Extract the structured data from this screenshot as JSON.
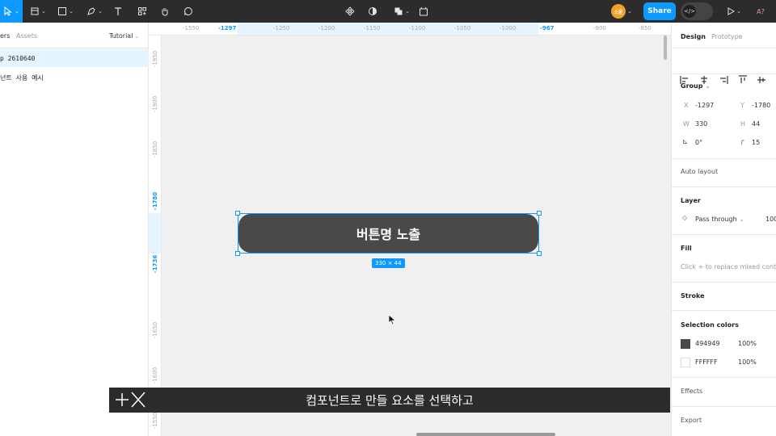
{
  "toolbar": {
    "share_label": "Share",
    "avatar_initials": "소윤",
    "zoom_label": "A?"
  },
  "left_panel": {
    "tab_layers": "ers",
    "tab_assets": "Assets",
    "page_selector": "Tutorial",
    "layers": [
      {
        "label": "p 2610640",
        "selected": true
      },
      {
        "label": "넌트 사용 예시",
        "selected": false
      }
    ]
  },
  "ruler": {
    "top_ticks": [
      "-1550",
      "-1297",
      "-1250",
      "-1200",
      "-1150",
      "-1100",
      "-1050",
      "-1000",
      "-967",
      "-900",
      "-850"
    ],
    "left_ticks": [
      "-1950",
      "-1900",
      "-1850",
      "-1780",
      "-1736",
      "-1650",
      "-1600",
      "-1550"
    ]
  },
  "canvas": {
    "button_text": "버튼명 노출",
    "size_badge": "330 × 44"
  },
  "subtitle": {
    "text": "컴포넌트로 만들 요소를 선택하고"
  },
  "right_panel": {
    "tab_design": "Design",
    "tab_prototype": "Prototype",
    "group_label": "Group",
    "x_label": "X",
    "x_value": "-1297",
    "y_label": "Y",
    "y_value": "-1780",
    "w_label": "W",
    "w_value": "330",
    "h_label": "H",
    "h_value": "44",
    "rotation_value": "0°",
    "radius_value": "15",
    "auto_layout": "Auto layout",
    "layer_title": "Layer",
    "blend_mode": "Pass through",
    "opacity": "100",
    "fill_title": "Fill",
    "fill_hint": "Click + to replace mixed content",
    "stroke_title": "Stroke",
    "selection_colors_title": "Selection colors",
    "colors": [
      {
        "hex": "494949",
        "opacity": "100%",
        "swatch": "#494949"
      },
      {
        "hex": "FFFFFF",
        "opacity": "100%",
        "swatch": "#FFFFFF"
      }
    ],
    "effects_title": "Effects",
    "export_title": "Export"
  },
  "colors": {
    "accent": "#0d99ff",
    "component_fill": "#494949"
  }
}
